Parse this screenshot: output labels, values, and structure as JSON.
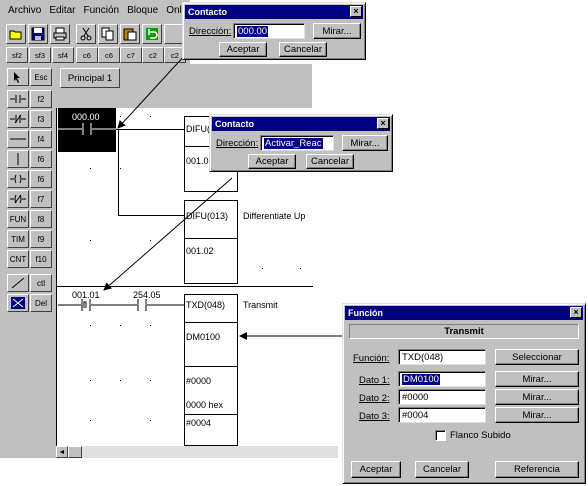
{
  "menu": {
    "items": [
      {
        "label": "Archivo"
      },
      {
        "label": "Editar"
      },
      {
        "label": "Función"
      },
      {
        "label": "Bloque"
      },
      {
        "label": "Onli"
      }
    ]
  },
  "toolbar": {
    "function_keys": [
      "sf2",
      "sf3",
      "sf4",
      "c6",
      "c6",
      "c7",
      "c2",
      "c2"
    ]
  },
  "palette": {
    "rows": [
      [
        "",
        "Esc"
      ],
      [
        "",
        "f2"
      ],
      [
        "",
        "f3"
      ],
      [
        "",
        "f4"
      ],
      [
        "",
        "f6"
      ],
      [
        "",
        "f6"
      ],
      [
        "",
        "f7"
      ],
      [
        "FUN",
        "f8"
      ],
      [
        "TIM",
        "f9"
      ],
      [
        "CNT",
        "f10"
      ],
      [
        "",
        "ctl"
      ],
      [
        "",
        "Del"
      ]
    ]
  },
  "program": {
    "tab_label": "Principal 1",
    "rung1_contact": "000.00",
    "rung1_instr1": "DIFU(0",
    "rung1_operand1": "001.0",
    "rung1_instr2": "DIFU(013)",
    "rung1_comment2": "Differentiate Up",
    "rung1_operand2": "001.02",
    "rung2_contact1": "001.01",
    "rung2_contact2": "254.05",
    "rung2_instr": "TXD(048)",
    "rung2_comment": "Transmit",
    "rung2_operand1": "DM0100",
    "rung2_operand2": "#0000",
    "rung2_operand2_note": "0000 hex",
    "rung2_operand3": "#0004"
  },
  "dialog_contacto_1": {
    "title": "Contacto",
    "direccion_label": "Dirección:",
    "direccion_value": "000.00",
    "mirar_button": "Mirar...",
    "aceptar_button": "Aceptar",
    "cancelar_button": "Cancelar"
  },
  "dialog_contacto_2": {
    "title": "Contacto",
    "direccion_label": "Dirección:",
    "direccion_value": "Activar_Reac",
    "mirar_button": "Mirar...",
    "aceptar_button": "Aceptar",
    "cancelar_button": "Cancelar"
  },
  "dialog_funcion": {
    "title": "Función",
    "header": "Transmit",
    "funcion_label": "Función:",
    "funcion_value": "TXD(048)",
    "seleccionar_button": "Seleccionar",
    "dato1_label": "Dato 1:",
    "dato1_value": "DM0100",
    "dato2_label": "Dato 2:",
    "dato2_value": "#0000",
    "dato3_label": "Dato 3:",
    "dato3_value": "#0004",
    "mirar_button": "Mirar...",
    "flanco_label": "Flanco Subido",
    "aceptar_button": "Aceptar",
    "cancelar_button": "Cancelar",
    "referencia_button": "Referencia"
  },
  "colors": {
    "titlebar": "#000080",
    "face": "#c0c0c0",
    "selection": "#000080"
  }
}
